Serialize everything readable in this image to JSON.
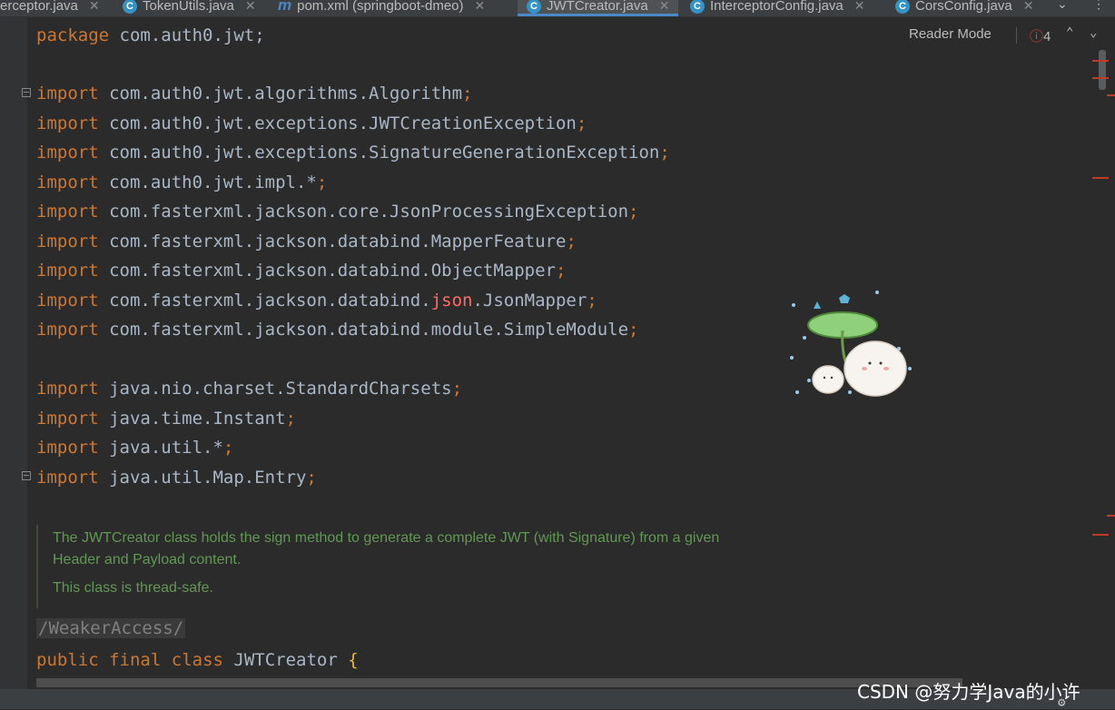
{
  "tabs": [
    {
      "label": "erceptor.java",
      "icon": "java-class-icon",
      "closable": true
    },
    {
      "label": "TokenUtils.java",
      "icon": "java-class-icon",
      "closable": true
    },
    {
      "label": "pom.xml (springboot-dmeo)",
      "icon": "maven-icon",
      "closable": true
    },
    {
      "label": "JWTCreator.java",
      "icon": "java-class-icon",
      "closable": true,
      "active": true
    },
    {
      "label": "InterceptorConfig.java",
      "icon": "java-class-icon",
      "closable": true
    },
    {
      "label": "CorsConfig.java",
      "icon": "java-class-icon",
      "closable": true
    }
  ],
  "editor": {
    "reader_mode": "Reader Mode",
    "error_count": "4",
    "package_line": {
      "kw": "package",
      "rest": " com.auth0.jwt;"
    },
    "imports": [
      {
        "kw": "import",
        "a": " com.auth0.jwt.algorithms.Algorithm",
        "b": "",
        "c": ";"
      },
      {
        "kw": "import",
        "a": " com.auth0.jwt.exceptions.JWTCreationException",
        "b": "",
        "c": ";"
      },
      {
        "kw": "import",
        "a": " com.auth0.jwt.exceptions.SignatureGenerationException",
        "b": "",
        "c": ";"
      },
      {
        "kw": "import",
        "a": " com.auth0.jwt.impl.*",
        "b": "",
        "c": ";"
      },
      {
        "kw": "import",
        "a": " com.fasterxml.jackson.core.JsonProcessingException",
        "b": "",
        "c": ";"
      },
      {
        "kw": "import",
        "a": " com.fasterxml.jackson.databind.MapperFeature",
        "b": "",
        "c": ";"
      },
      {
        "kw": "import",
        "a": " com.fasterxml.jackson.databind.ObjectMapper",
        "b": "",
        "c": ";"
      },
      {
        "kw": "import",
        "a": " com.fasterxml.jackson.databind.",
        "b": "json",
        "c2": ".JsonMapper",
        "c": ";"
      },
      {
        "kw": "import",
        "a": " com.fasterxml.jackson.databind.module.SimpleModule",
        "b": "",
        "c": ";"
      },
      {
        "kw": "import",
        "a": " java.nio.charset.StandardCharsets",
        "b": "",
        "c": ";"
      },
      {
        "kw": "import",
        "a": " java.time.Instant",
        "b": "",
        "c": ";"
      },
      {
        "kw": "import",
        "a": " java.util.*",
        "b": "",
        "c": ";"
      },
      {
        "kw": "import",
        "a": " java.util.Map.Entry",
        "b": "",
        "c": ";"
      }
    ],
    "doc_line1": "The JWTCreator class holds the sign method to generate a complete JWT (with Signature) from a given",
    "doc_line2": "Header and Payload content.",
    "doc_line3": "This class is thread-safe.",
    "suppress": "/WeakerAccess/",
    "class_decl": {
      "kw1": "public",
      "kw2": "final",
      "kw3": "class",
      "name": "JWTCreator",
      "brace": "{"
    }
  },
  "watermark": "CSDN @努力学Java的小许",
  "colors": {
    "keyword": "#cc7832",
    "plain": "#a9b7c6",
    "doc": "#629755",
    "error": "#ff6b68",
    "accent": "#4a88c7"
  }
}
